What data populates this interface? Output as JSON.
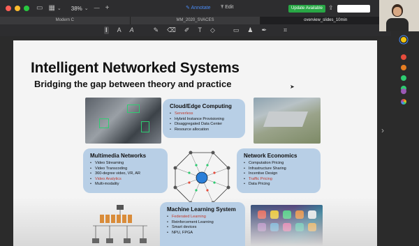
{
  "toolbar": {
    "zoom": "38%",
    "zoom_minus": "—",
    "zoom_plus": "+",
    "annotate_label": "Annotate",
    "edit_label": "Edit",
    "update_label": "Update Available",
    "colors": {
      "close": "#ff5f57",
      "minimize": "#febc2e",
      "maximize": "#28c840",
      "annotate": "#4a8cf7",
      "update": "#28a745"
    }
  },
  "tabs": [
    {
      "label": "Modern C"
    },
    {
      "label": "MM_2020_SVACES"
    },
    {
      "label": "overview_slides_10min"
    }
  ],
  "palette": [
    "#f2c40f",
    "#e74c3c",
    "#e67e22",
    "#2ecc71",
    "#2ecc71",
    "#9b59b6",
    "#b0b0b0"
  ],
  "slide": {
    "title": "Intelligent Networked Systems",
    "subtitle": "Bridging the gap between theory and practice",
    "boxes": {
      "cloud": {
        "title": "Cloud/Edge Computing",
        "items": [
          {
            "text": "Serverless",
            "highlight": true
          },
          {
            "text": "Hybrid Instance Provisioning",
            "highlight": false
          },
          {
            "text": "Disaggregated Data Center",
            "highlight": false
          },
          {
            "text": "Resource allocation",
            "highlight": false
          }
        ]
      },
      "multimedia": {
        "title": "Multimedia Networks",
        "items": [
          {
            "text": "Video Streaming",
            "highlight": false
          },
          {
            "text": "Video Transcoding",
            "highlight": false
          },
          {
            "text": "360-degree video, VR, AR",
            "highlight": false
          },
          {
            "text": "Video Analytics",
            "highlight": true
          },
          {
            "text": "Multi-modality",
            "highlight": false
          }
        ]
      },
      "economics": {
        "title": "Network Economics",
        "items": [
          {
            "text": "Computation Pricing",
            "highlight": false
          },
          {
            "text": "Infrastructure Sharing",
            "highlight": false
          },
          {
            "text": "Incentive Design",
            "highlight": false
          },
          {
            "text": "Traffic Pricing",
            "highlight": true
          },
          {
            "text": "Data Pricing",
            "highlight": false
          }
        ]
      },
      "ml": {
        "title": "Machine Learning System",
        "items": [
          {
            "text": "Federated Learning",
            "highlight": true
          },
          {
            "text": "Reinforcement Learning",
            "highlight": false
          },
          {
            "text": "Smart devices",
            "highlight": false
          },
          {
            "text": "NPU, FPGA",
            "highlight": false
          }
        ]
      }
    }
  }
}
